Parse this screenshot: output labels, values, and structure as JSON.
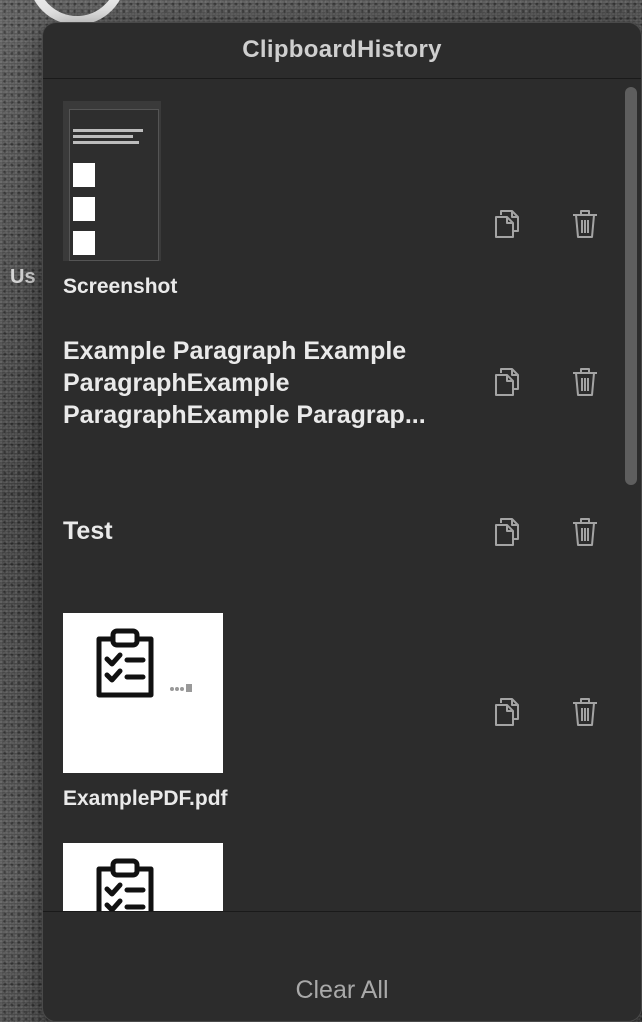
{
  "window": {
    "title": "ClipboardHistory"
  },
  "background_text": "Us",
  "items": [
    {
      "type": "image",
      "label": "Screenshot"
    },
    {
      "type": "text",
      "text": "Example Paragraph Example ParagraphExample ParagraphExample Paragrap..."
    },
    {
      "type": "text",
      "text": "Test"
    },
    {
      "type": "file",
      "label": "ExamplePDF.pdf"
    },
    {
      "type": "file",
      "label": ""
    }
  ],
  "icons": {
    "copy": "copy-icon",
    "delete": "trash-icon",
    "thumbnail": "clipboard-checklist-icon"
  },
  "footer": {
    "clear_label": "Clear All"
  },
  "colors": {
    "panel": "#2c2c2c",
    "text": "#eaeaea",
    "muted": "#a9a9a9"
  }
}
